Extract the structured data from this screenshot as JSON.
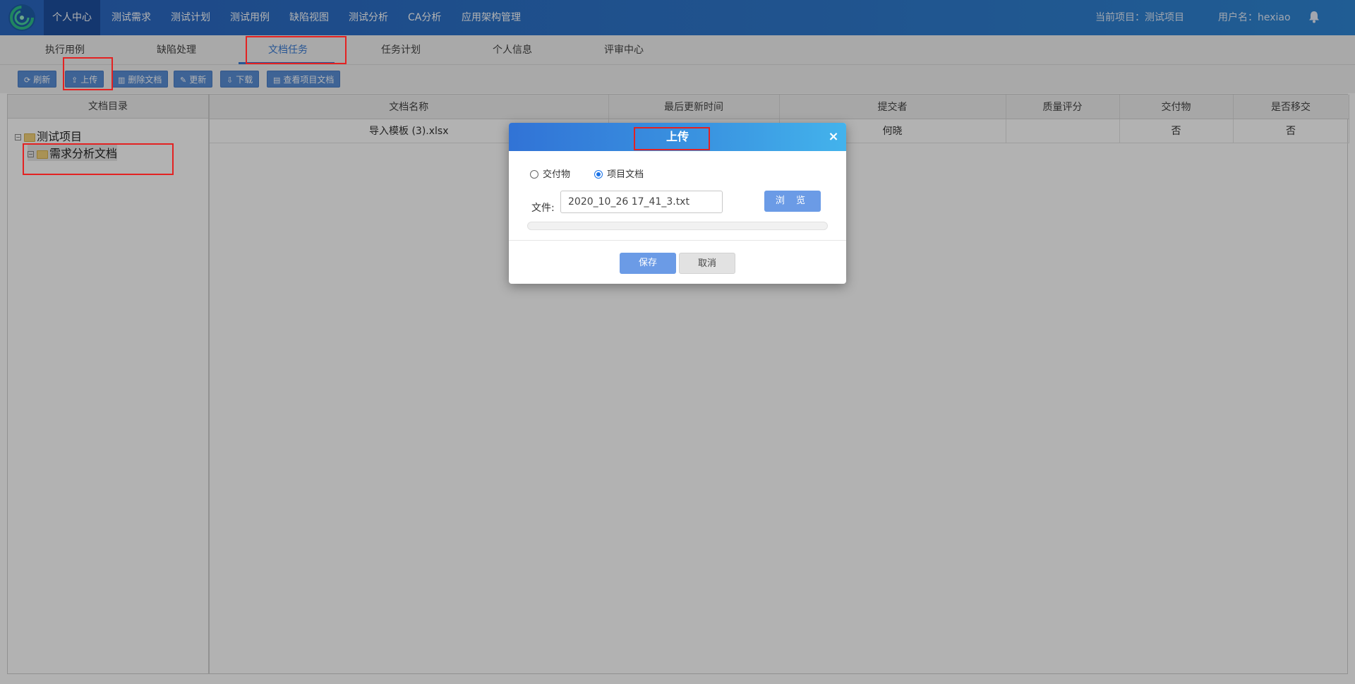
{
  "nav": {
    "items": [
      {
        "label": "个人中心"
      },
      {
        "label": "测试需求"
      },
      {
        "label": "测试计划"
      },
      {
        "label": "测试用例"
      },
      {
        "label": "缺陷视图"
      },
      {
        "label": "测试分析"
      },
      {
        "label": "CA分析"
      },
      {
        "label": "应用架构管理"
      }
    ],
    "active_index": 0,
    "current_project": "当前项目：测试项目",
    "username": "用户名：hexiao",
    "icons": {
      "logo": "swirl-logo-icon",
      "notifications": "bell-icon"
    }
  },
  "tabs": {
    "items": [
      {
        "label": "执行用例"
      },
      {
        "label": "缺陷处理"
      },
      {
        "label": "文档任务"
      },
      {
        "label": "任务计划"
      },
      {
        "label": "个人信息"
      },
      {
        "label": "评审中心"
      }
    ],
    "active_index": 2
  },
  "toolbar": {
    "refresh": {
      "label": "刷新",
      "icon": "refresh-icon"
    },
    "upload": {
      "label": "上传",
      "icon": "upload-icon"
    },
    "delete_doc": {
      "label": "删除文档",
      "icon": "trash-icon"
    },
    "update": {
      "label": "更新",
      "icon": "edit-icon"
    },
    "download": {
      "label": "下载",
      "icon": "download-icon"
    },
    "view_project_docs": {
      "label": "查看项目文档",
      "icon": "document-icon"
    }
  },
  "tree": {
    "header": "文档目录",
    "nodes": [
      {
        "label": "测试项目",
        "level": 0,
        "expanded": true
      },
      {
        "label": "需求分析文档",
        "level": 1,
        "expanded": true,
        "selected": true
      }
    ]
  },
  "table": {
    "headers": [
      "文档名称",
      "最后更新时间",
      "提交者",
      "质量评分",
      "交付物",
      "是否移交"
    ],
    "rows": [
      [
        "导入模板 (3).xlsx",
        "",
        "何晓",
        "",
        "否",
        "否"
      ]
    ]
  },
  "modal": {
    "title": "上传",
    "close_symbol": "×",
    "radio_options": [
      {
        "label": "交付物",
        "checked": false
      },
      {
        "label": "项目文档",
        "checked": true
      }
    ],
    "file_label": "文件:",
    "file_value": "2020_10_26 17_41_3.txt",
    "browse_label": "浏 览",
    "progress_percent": 0,
    "save_label": "保存",
    "cancel_label": "取消"
  },
  "colors": {
    "nav_bg": "#2e78cc",
    "nav_active": "#1d4fa0",
    "tab_active": "#3a7bd5",
    "toolbar_button": "#5a8ed6",
    "modal_button": "#6b9be6",
    "annotation": "#e32222"
  }
}
